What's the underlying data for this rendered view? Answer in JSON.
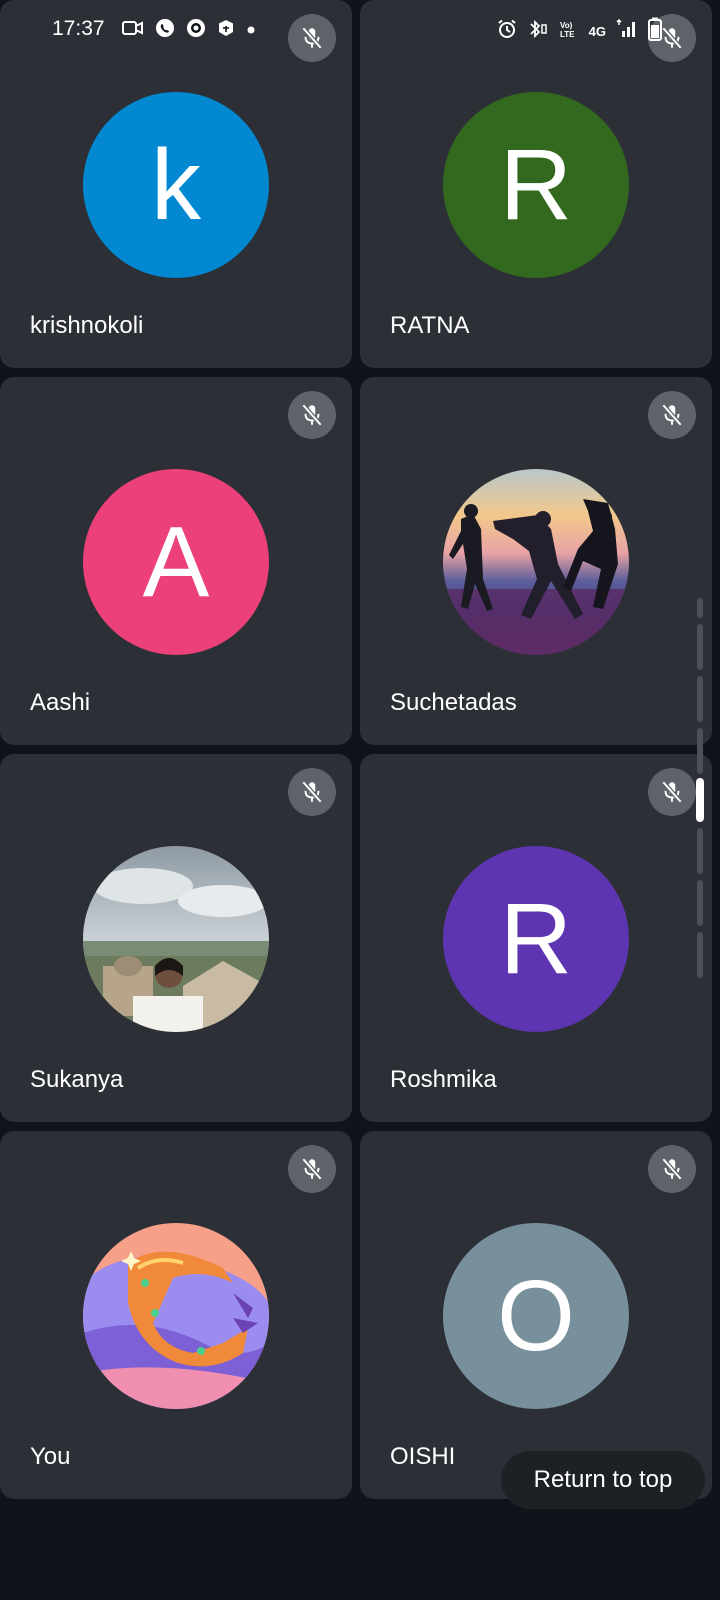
{
  "status_bar": {
    "time": "17:37",
    "left_icons": [
      "video-camera-icon",
      "whatsapp-icon",
      "circle-icon",
      "box-icon",
      "dot-icon"
    ],
    "right_icons": [
      "alarm-icon",
      "bluetooth-icon",
      "volte-icon",
      "network-4g",
      "signal-icon",
      "battery-icon"
    ],
    "network_label": "4G"
  },
  "participants": [
    {
      "name": "krishnokoli",
      "avatar_type": "letter",
      "letter": "k",
      "color": "#0288d1",
      "muted": true
    },
    {
      "name": "RATNA",
      "avatar_type": "letter",
      "letter": "R",
      "color": "#33691e",
      "muted": true
    },
    {
      "name": "Aashi",
      "avatar_type": "letter",
      "letter": "A",
      "color": "#ec407a",
      "muted": true
    },
    {
      "name": "Suchetadas",
      "avatar_type": "photo",
      "photo": "yoga-silhouettes-photo",
      "muted": true
    },
    {
      "name": "Sukanya",
      "avatar_type": "photo",
      "photo": "person-cityscape-photo",
      "muted": true
    },
    {
      "name": "Roshmika",
      "avatar_type": "letter",
      "letter": "R",
      "color": "#5e35b1",
      "muted": true
    },
    {
      "name": "You",
      "avatar_type": "photo",
      "photo": "crown-illustration",
      "muted": true
    },
    {
      "name": "OISHI",
      "avatar_type": "letter",
      "letter": "O",
      "color": "#78909c",
      "muted": true
    }
  ],
  "return_to_top_label": "Return to top",
  "colors": {
    "background": "#0f141b",
    "tile": "#2c3036",
    "mute_badge": "#5e6369"
  }
}
